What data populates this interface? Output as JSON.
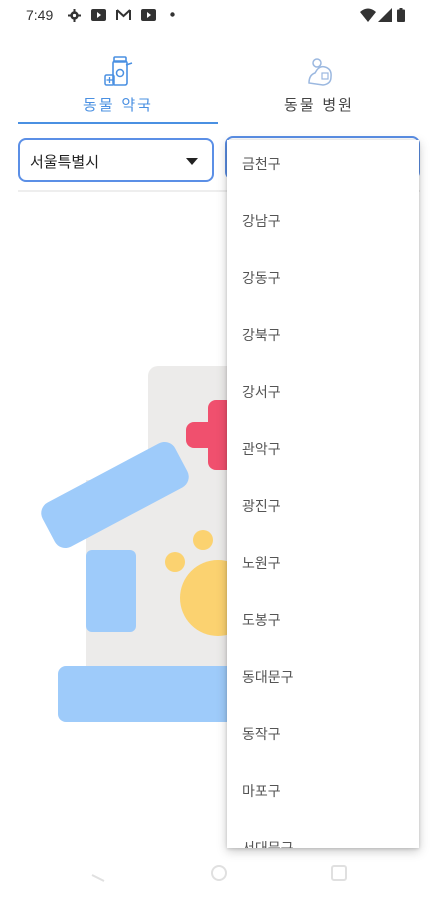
{
  "status_bar": {
    "time": "7:49",
    "left_icons": [
      "gear-icon",
      "youtube-icon",
      "gmail-icon",
      "youtube-icon",
      "dot-icon"
    ],
    "right_icons": [
      "wifi-icon",
      "signal-icon",
      "battery-icon"
    ]
  },
  "tabs": [
    {
      "label": "동물 약국",
      "icon": "pharmacy-icon",
      "active": true
    },
    {
      "label": "동물 병원",
      "icon": "hospital-icon",
      "active": false
    }
  ],
  "city_select": {
    "value": "서울특별시"
  },
  "district_dropdown": {
    "options": [
      "금천구",
      "강남구",
      "강동구",
      "강북구",
      "강서구",
      "관악구",
      "광진구",
      "노원구",
      "도봉구",
      "동대문구",
      "동작구",
      "마포구",
      "서대문구"
    ]
  },
  "colors": {
    "accent": "#4a90e2",
    "cross_red": "#f0506e",
    "blue_shape": "#9ecbfa",
    "yellow_shape": "#fbd270",
    "wall": "#ecebea"
  }
}
